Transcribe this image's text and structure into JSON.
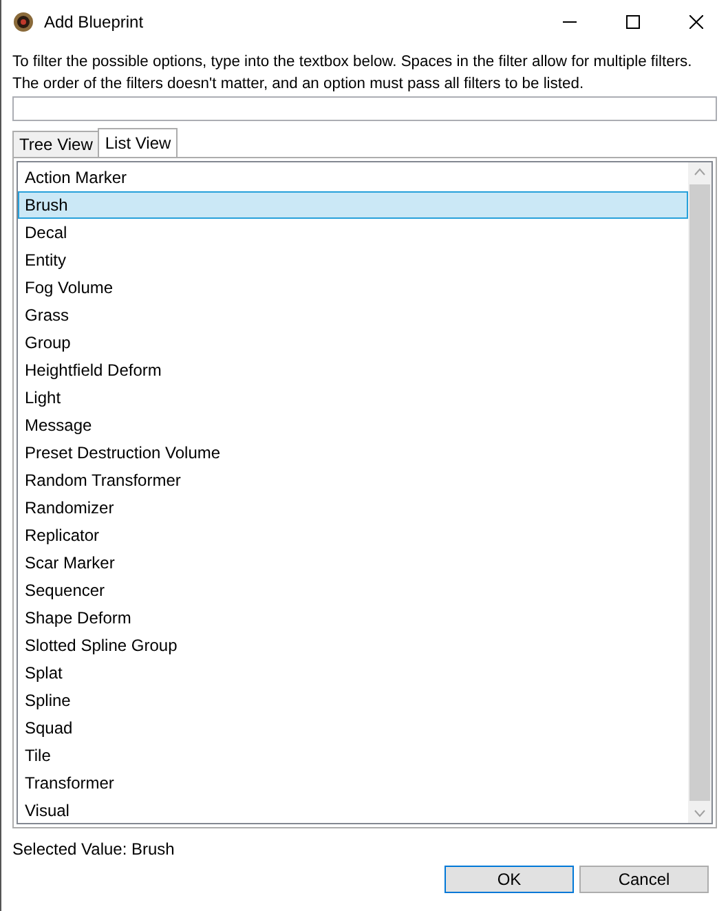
{
  "window": {
    "title": "Add Blueprint"
  },
  "description": "To filter the possible options, type into the textbox below. Spaces in the filter allow for multiple filters. The order of the filters doesn't matter, and an option must pass all filters to be listed.",
  "tabs": [
    {
      "label": "Tree View",
      "selected": false
    },
    {
      "label": "List View",
      "selected": true
    }
  ],
  "items": [
    {
      "label": "Action Marker",
      "selected": false
    },
    {
      "label": "Brush",
      "selected": true
    },
    {
      "label": "Decal",
      "selected": false
    },
    {
      "label": "Entity",
      "selected": false
    },
    {
      "label": "Fog Volume",
      "selected": false
    },
    {
      "label": "Grass",
      "selected": false
    },
    {
      "label": "Group",
      "selected": false
    },
    {
      "label": "Heightfield Deform",
      "selected": false
    },
    {
      "label": "Light",
      "selected": false
    },
    {
      "label": "Message",
      "selected": false
    },
    {
      "label": "Preset Destruction Volume",
      "selected": false
    },
    {
      "label": "Random Transformer",
      "selected": false
    },
    {
      "label": "Randomizer",
      "selected": false
    },
    {
      "label": "Replicator",
      "selected": false
    },
    {
      "label": "Scar Marker",
      "selected": false
    },
    {
      "label": "Sequencer",
      "selected": false
    },
    {
      "label": "Shape Deform",
      "selected": false
    },
    {
      "label": "Slotted Spline Group",
      "selected": false
    },
    {
      "label": "Splat",
      "selected": false
    },
    {
      "label": "Spline",
      "selected": false
    },
    {
      "label": "Squad",
      "selected": false
    },
    {
      "label": "Tile",
      "selected": false
    },
    {
      "label": "Transformer",
      "selected": false
    },
    {
      "label": "Visual",
      "selected": false
    }
  ],
  "selected_value": "Selected Value: Brush",
  "buttons": [
    {
      "label": "OK",
      "default": true
    },
    {
      "label": "Cancel",
      "default": false
    }
  ]
}
